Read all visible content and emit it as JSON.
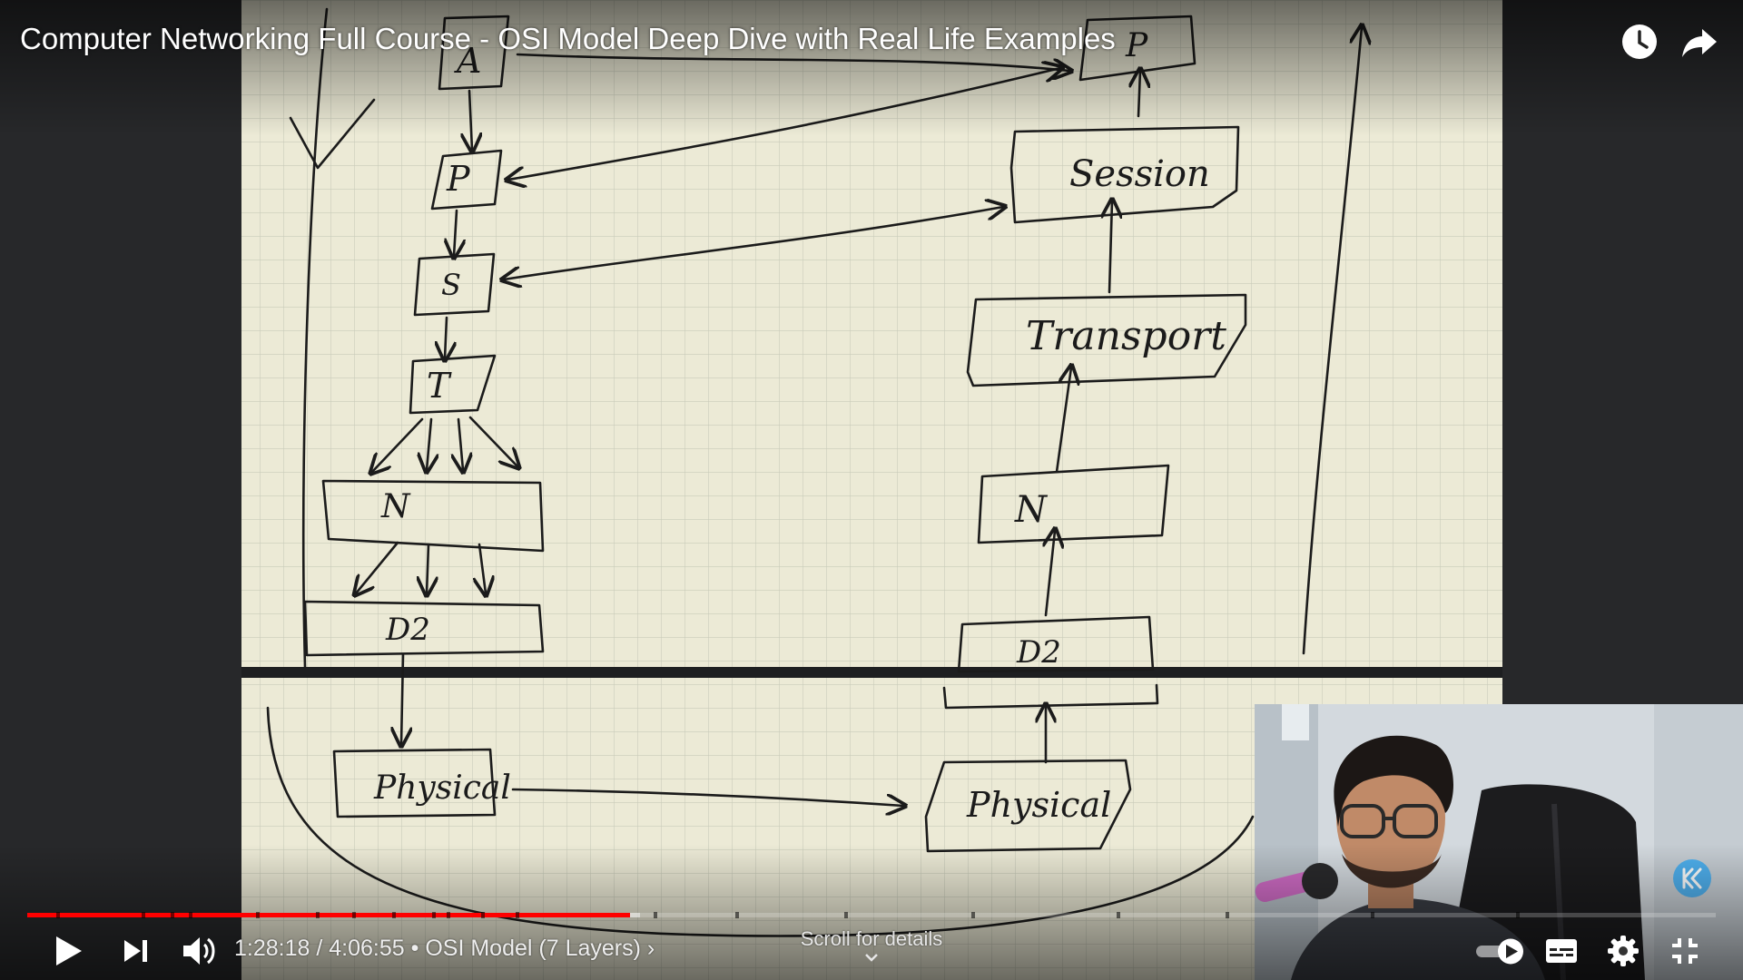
{
  "video": {
    "title": "Computer Networking Full Course - OSI Model Deep Dive with Real Life Examples"
  },
  "whiteboard": {
    "left_stack": [
      "A",
      "P",
      "S",
      "T",
      "N",
      "D2",
      "Physical"
    ],
    "right_stack": [
      "P",
      "Session",
      "Transport",
      "N",
      "D2",
      "Physical"
    ]
  },
  "player": {
    "current_time": "1:28:18",
    "duration": "4:06:55",
    "separator": " / ",
    "bullet": " • ",
    "chapter": "OSI Model (7 Layers)",
    "chapter_arrow": " ›",
    "scroll_hint": "Scroll for details",
    "progress_played_fraction": 0.357,
    "progress_buffered_fraction": 0.363,
    "progress_color": "#ff0000"
  },
  "controls": {
    "play_icon": "play-icon",
    "next_icon": "next-icon",
    "volume_icon": "volume-icon",
    "autoplay_icon": "autoplay-toggle-icon",
    "captions_icon": "subtitles-icon",
    "settings_icon": "gear-icon",
    "fullscreen_icon": "exit-fullscreen-icon",
    "watch_later_icon": "clock-icon",
    "share_icon": "share-icon"
  }
}
